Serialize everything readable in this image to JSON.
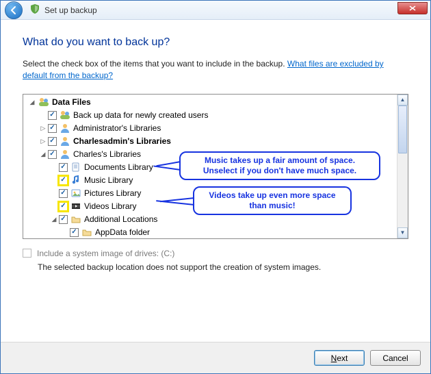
{
  "window": {
    "title": "Set up backup"
  },
  "page": {
    "heading": "What do you want to back up?",
    "subtext": "Select the check box of the items that you want to include in the backup. ",
    "help_link": "What files are excluded by default from the backup?"
  },
  "tree": {
    "root": {
      "label": "Data Files"
    },
    "items": [
      {
        "label": "Back up data for newly created users"
      },
      {
        "label": "Administrator's Libraries"
      },
      {
        "label": "Charlesadmin's Libraries"
      },
      {
        "label": "Charles's Libraries"
      }
    ],
    "charles_children": [
      {
        "label": "Documents Library"
      },
      {
        "label": "Music Library"
      },
      {
        "label": "Pictures Library"
      },
      {
        "label": "Videos Library"
      },
      {
        "label": "Additional Locations"
      }
    ],
    "additional_children": [
      {
        "label": "AppData folder"
      }
    ]
  },
  "annotations": {
    "music": "Music takes up a fair amount of space. Unselect if you don't have much space.",
    "videos": "Videos take up even more space than music!"
  },
  "sysimg": {
    "label": "Include a system image of drives: (C:)",
    "note": "The selected backup location does not support the creation of system images."
  },
  "buttons": {
    "next_pre": "N",
    "next_post": "ext",
    "cancel": "Cancel"
  },
  "icons": {
    "back": "back-icon",
    "shield": "shield-icon",
    "close": "close-icon"
  }
}
